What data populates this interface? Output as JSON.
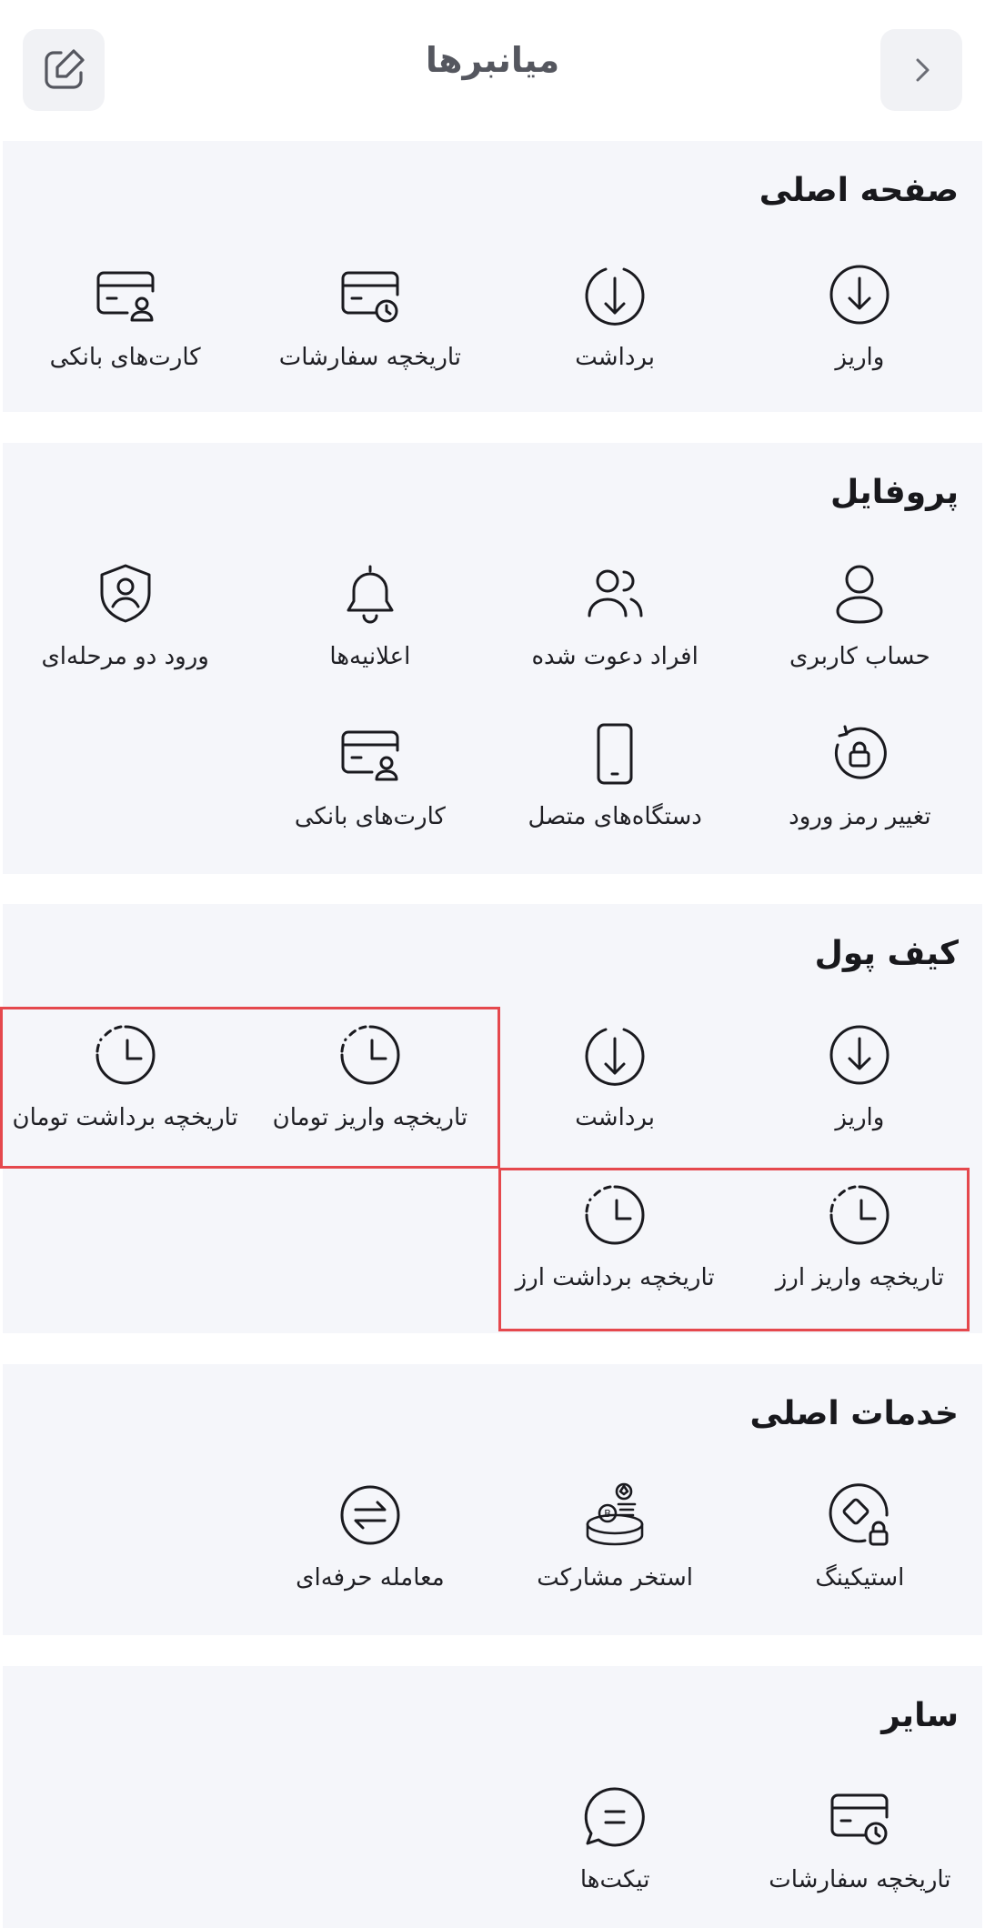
{
  "header": {
    "title": "میانبرها",
    "edit_icon": "edit-icon",
    "back_icon": "chevron-right-icon"
  },
  "sections": [
    {
      "title": "صفحه اصلی",
      "items": [
        {
          "label": "واریز",
          "icon": "deposit-icon"
        },
        {
          "label": "برداشت",
          "icon": "withdraw-icon"
        },
        {
          "label": "تاریخچه سفارشات",
          "icon": "order-history-icon"
        },
        {
          "label": "کارت‌های بانکی",
          "icon": "bank-card-icon"
        }
      ]
    },
    {
      "title": "پروفایل",
      "items": [
        {
          "label": "حساب کاربری",
          "icon": "user-icon"
        },
        {
          "label": "افراد دعوت شده",
          "icon": "users-icon"
        },
        {
          "label": "اعلانیه‌ها",
          "icon": "bell-icon"
        },
        {
          "label": "ورود دو مرحله‌ای",
          "icon": "shield-user-icon"
        },
        {
          "label": "تغییر رمز ورود",
          "icon": "lock-rotate-icon"
        },
        {
          "label": "دستگاه‌های متصل",
          "icon": "mobile-icon"
        },
        {
          "label": "کارت‌های بانکی",
          "icon": "bank-card-icon"
        }
      ]
    },
    {
      "title": "کیف پول",
      "items": [
        {
          "label": "واریز",
          "icon": "deposit-icon"
        },
        {
          "label": "برداشت",
          "icon": "withdraw-icon"
        },
        {
          "label": "تاریخچه واریز تومان",
          "icon": "clock-icon"
        },
        {
          "label": "تاریخچه برداشت تومان",
          "icon": "clock-icon"
        },
        {
          "label": "تاریخچه واریز ارز",
          "icon": "clock-icon"
        },
        {
          "label": "تاریخچه برداشت ارز",
          "icon": "clock-icon"
        }
      ]
    },
    {
      "title": "خدمات اصلی",
      "items": [
        {
          "label": "استیکینگ",
          "icon": "staking-icon"
        },
        {
          "label": "استخر مشارکت",
          "icon": "pool-icon"
        },
        {
          "label": "معامله حرفه‌ای",
          "icon": "exchange-icon"
        }
      ]
    },
    {
      "title": "سایر",
      "items": [
        {
          "label": "تاریخچه سفارشات",
          "icon": "order-history-icon"
        },
        {
          "label": "تیکت‌ها",
          "icon": "chat-icon"
        }
      ]
    }
  ],
  "colors": {
    "section_bg": "#f5f6fa",
    "highlight": "#e5484d",
    "text": "#1f1f24",
    "header_title": "#55575f"
  }
}
